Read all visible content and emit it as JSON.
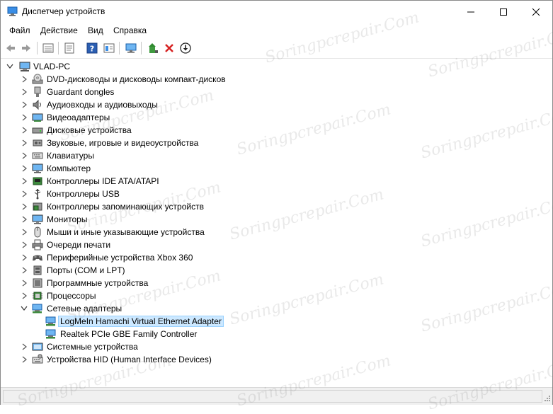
{
  "window": {
    "title": "Диспетчер устройств",
    "icon": "device-manager-icon",
    "controls": {
      "minimize": "minimize-icon",
      "maximize": "maximize-icon",
      "close": "close-icon"
    }
  },
  "menu": [
    "Файл",
    "Действие",
    "Вид",
    "Справка"
  ],
  "toolbar": {
    "buttons": [
      "back-arrow-icon",
      "forward-arrow-icon",
      "properties-list-icon",
      "update-driver-icon",
      "help-icon",
      "view-icon",
      "monitor-scan-icon",
      "enable-device-icon",
      "uninstall-x-icon",
      "download-driver-icon"
    ]
  },
  "tree": {
    "root": {
      "label": "VLAD-PC",
      "icon": "computer-icon",
      "expanded": true
    },
    "items": [
      {
        "label": "DVD-дисководы и дисководы компакт-дисков",
        "icon": "dvd-drive-icon"
      },
      {
        "label": "Guardant dongles",
        "icon": "usb-key-icon"
      },
      {
        "label": "Аудиовходы и аудиовыходы",
        "icon": "speaker-icon"
      },
      {
        "label": "Видеоадаптеры",
        "icon": "display-adapter-icon"
      },
      {
        "label": "Дисковые устройства",
        "icon": "disk-drive-icon"
      },
      {
        "label": "Звуковые, игровые и видеоустройства",
        "icon": "sound-icon"
      },
      {
        "label": "Клавиатуры",
        "icon": "keyboard-icon"
      },
      {
        "label": "Компьютер",
        "icon": "monitor-icon"
      },
      {
        "label": "Контроллеры IDE ATA/ATAPI",
        "icon": "ide-controller-icon"
      },
      {
        "label": "Контроллеры USB",
        "icon": "usb-icon"
      },
      {
        "label": "Контроллеры запоминающих устройств",
        "icon": "storage-controller-icon"
      },
      {
        "label": "Мониторы",
        "icon": "monitor-icon"
      },
      {
        "label": "Мыши и иные указывающие устройства",
        "icon": "mouse-icon"
      },
      {
        "label": "Очереди печати",
        "icon": "printer-icon"
      },
      {
        "label": "Периферийные устройства Xbox 360",
        "icon": "gamepad-icon"
      },
      {
        "label": "Порты (COM и LPT)",
        "icon": "port-icon"
      },
      {
        "label": "Программные устройства",
        "icon": "software-device-icon"
      },
      {
        "label": "Процессоры",
        "icon": "cpu-icon"
      },
      {
        "label": "Сетевые адаптеры",
        "icon": "network-adapter-icon",
        "expanded": true,
        "children": [
          {
            "label": "LogMeIn Hamachi Virtual Ethernet Adapter",
            "icon": "network-adapter-icon",
            "selected": true
          },
          {
            "label": "Realtek PCIe GBE Family Controller",
            "icon": "network-adapter-icon"
          }
        ]
      },
      {
        "label": "Системные устройства",
        "icon": "system-device-icon"
      },
      {
        "label": "Устройства HID (Human Interface Devices)",
        "icon": "hid-icon"
      }
    ]
  },
  "watermark": "Soringpcrepair.Com",
  "colors": {
    "selection": "#cce8ff",
    "selection_border": "#99d1ff",
    "accent": "#2b79d0"
  }
}
